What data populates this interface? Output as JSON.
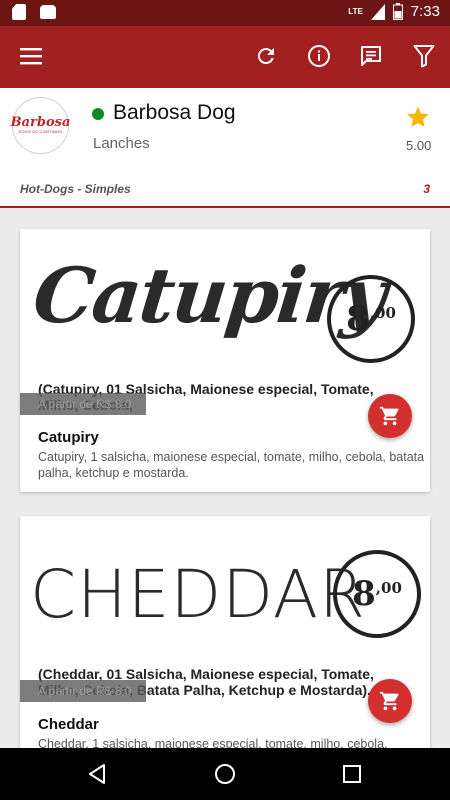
{
  "status_bar": {
    "network": "LTE",
    "time": "7:33"
  },
  "header": {
    "logo_text": "Barbosa",
    "logo_subtext": "DOGS DO CANTINHO",
    "shop_name": "Barbosa Dog",
    "category": "Lanches",
    "rating": "5.00",
    "status_color": "#0d8a1d",
    "star_color": "#f5b800"
  },
  "section": {
    "title": "Hot-Dogs - Simples",
    "count": "3"
  },
  "items": [
    {
      "image_title": "Catupiry",
      "image_price_main": "8",
      "image_price_cents": ",00",
      "image_description": "(Catupiry, 01 Salsicha, Maionese especial, Tomate, Milho, Cebola,",
      "price_badge": "A partir de R$ 8,0",
      "name": "Catupiry",
      "description": "Catupiry, 1 salsicha, maionese especial, tomate, milho, cebola, batata palha, ketchup e mostarda."
    },
    {
      "image_title": "CHEDDAR",
      "image_price_main": "8",
      "image_price_cents": ",00",
      "image_description": "(Cheddar, 01 Salsicha, Maionese especial, Tomate, Milho, Cebola, Batata Palha, Ketchup e Mostarda).",
      "price_badge": "A partir de R$ 8,0",
      "name": "Cheddar",
      "description": "Cheddar, 1 salsicha, maionese especial, tomate, milho, cebola,"
    }
  ],
  "colors": {
    "toolbar": "#a32020",
    "statusbar": "#6d1414",
    "accent": "#d32f2f"
  },
  "icons": [
    "menu-icon",
    "refresh-icon",
    "info-icon",
    "chat-icon",
    "filter-icon",
    "star-icon",
    "cart-icon",
    "back-icon",
    "home-icon",
    "recents-icon"
  ]
}
